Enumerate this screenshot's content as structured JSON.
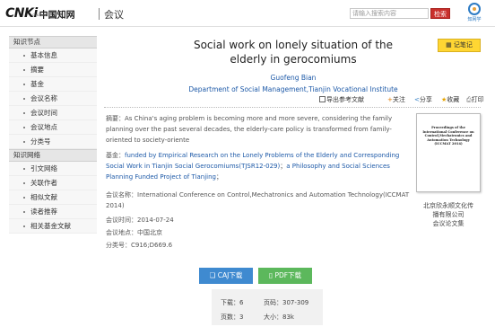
{
  "header": {
    "logo_mark": "CNKi",
    "logo_cn": "中国知网",
    "logo_sub": "cnki.net",
    "section": "会议",
    "search_placeholder": "请输入搜索内容",
    "search_button": "检索",
    "brand2_text": "知网学"
  },
  "sidebar": {
    "group1_title": "知识节点",
    "group1_items": [
      "基本信息",
      "摘要",
      "基金",
      "会议名称",
      "会议时间",
      "会议地点",
      "分类号"
    ],
    "group2_title": "知识网络",
    "group2_items": [
      "引文网络",
      "关联作者",
      "相似文献",
      "读者推荐",
      "相关基金文献"
    ]
  },
  "paper": {
    "title": "Social work on lonely situation of the elderly in gerocomiums",
    "author": "Guofeng Bian",
    "affiliation": "Department of Social Management,Tianjin Vocational Institute",
    "record_button": "记笔记",
    "toolbar": {
      "export": "导出参考文献",
      "follow": "关注",
      "share": "分享",
      "favorite": "收藏",
      "print": "打印"
    },
    "abstract_label": "摘要：",
    "abstract": "As China's aging problem is becoming more and more severe, considering the family planning over the past several decades, the elderly-care policy is transformed from family-oriented to society-oriente",
    "fund_label": "基金：",
    "fund_part1": "funded by Empirical Research on the Lonely Problems of the Elderly and Corresponding Social Work in Tianjin Social Gerocomiums(TJSR12-029)",
    "fund_sep": "；",
    "fund_part2": "a Philosophy and Social Sciences Planning Funded Project of Tianjing",
    "fund_end": "；",
    "conf_label": "会议名称：",
    "conf": "International Conference on Control,Mechatronics and Automation Technology(ICCMAT 2014)",
    "time_label": "会议时间：",
    "time": "2014-07-24",
    "place_label": "会议地点：",
    "place": "中国北京",
    "class_label": "分类号：",
    "class": "C916;D669.6"
  },
  "cover": {
    "text": "Proceedings of the International Conference on Control,Mechatronics and Automation Technology (ICCMAT 2014)"
  },
  "publisher": {
    "line1": "北京欣永顺文化传",
    "line2": "播有限公司",
    "line3": "会议论文集"
  },
  "downloads": {
    "caj": "CAJ下载",
    "pdf": "PDF下载"
  },
  "stats": {
    "downloads_label": "下载：",
    "downloads": "6",
    "pages_label": "页码：",
    "pages": "307-309",
    "page_count_label": "页数：",
    "page_count": "3",
    "size_label": "大小：",
    "size": "83k"
  },
  "colors": {
    "link_blue": "#1e5aa8",
    "caj_blue": "#3f8ad0",
    "pdf_green": "#5cb85c",
    "search_red": "#c9302c",
    "note_yellow": "#ffd633"
  }
}
